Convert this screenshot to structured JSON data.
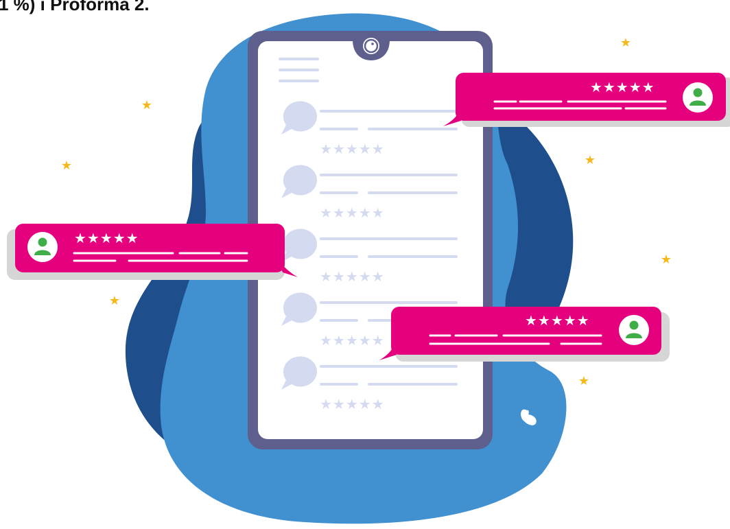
{
  "header": {
    "text": "1 %) i Proforma 2."
  },
  "colors": {
    "blob_light": "#4190d0",
    "blob_dark": "#1e4e8c",
    "phone_frame": "#5f5f8e",
    "phone_screen": "#ffffff",
    "placeholder": "#d4daf0",
    "bubble": "#e5007d",
    "bubble_shadow": "#d6d6d6",
    "star_gold": "#f6b81a",
    "avatar_green": "#3fae49"
  },
  "icons": {
    "camera": "phone-camera-icon",
    "chat": "chat-bubble-icon",
    "avatar": "user-avatar-icon",
    "star": "star-icon",
    "heart": "heart-icon"
  },
  "rating_glyphs": "★★★★★",
  "reviews": [
    {
      "rating": 5
    },
    {
      "rating": 5
    },
    {
      "rating": 5
    }
  ]
}
